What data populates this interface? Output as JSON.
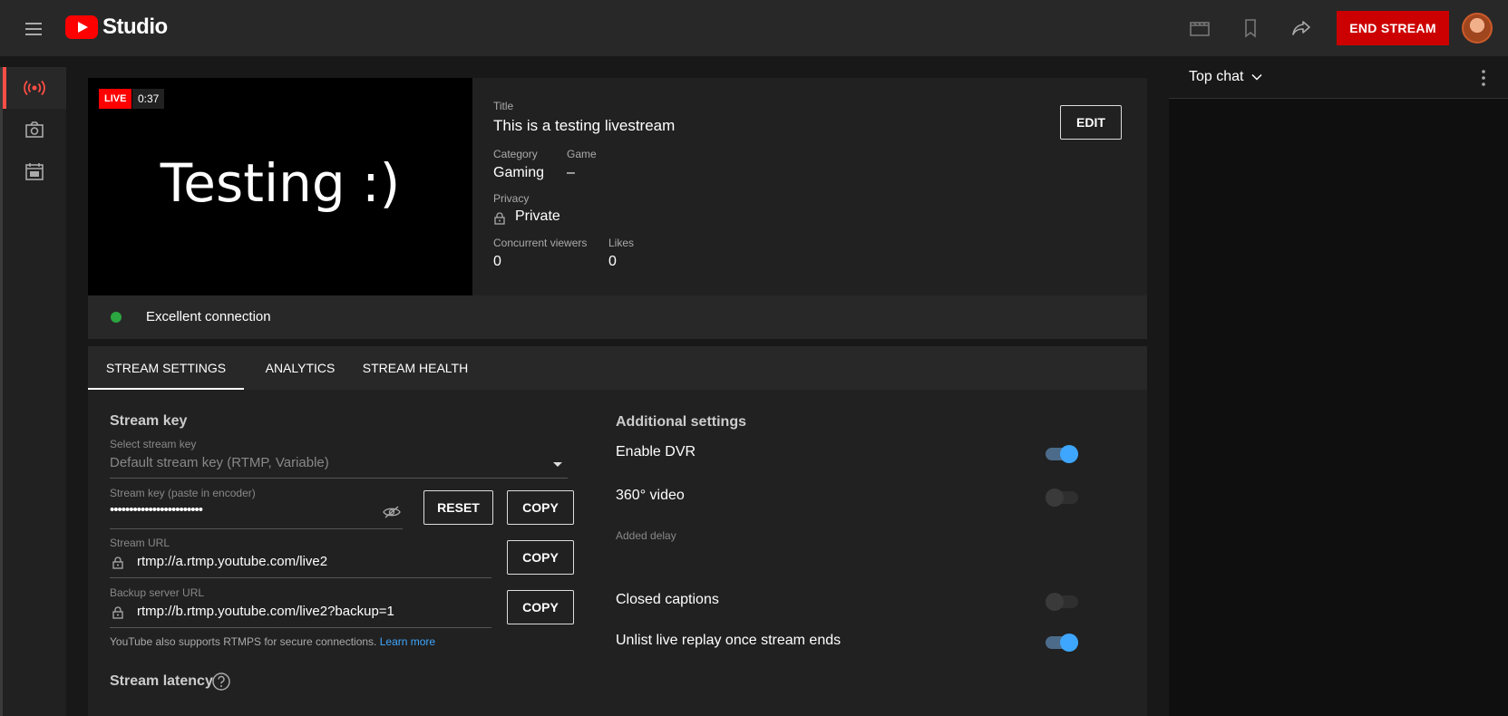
{
  "app": {
    "logo_text": "Studio"
  },
  "header": {
    "end_stream_label": "END STREAM"
  },
  "preview": {
    "live_label": "LIVE",
    "elapsed": "0:37",
    "overlay_text": "Testing :)"
  },
  "stream_info": {
    "title_label": "Title",
    "title_value": "This is a testing livestream",
    "category_label": "Category",
    "category_value": "Gaming",
    "game_label": "Game",
    "game_value": "–",
    "privacy_label": "Privacy",
    "privacy_value": "Private",
    "viewers_label": "Concurrent viewers",
    "viewers_value": "0",
    "likes_label": "Likes",
    "likes_value": "0",
    "edit_label": "EDIT"
  },
  "connection": {
    "status_text": "Excellent connection",
    "status_color": "#2ba640"
  },
  "tabs": [
    {
      "label": "STREAM SETTINGS",
      "active": true
    },
    {
      "label": "ANALYTICS",
      "active": false
    },
    {
      "label": "STREAM HEALTH",
      "active": false
    }
  ],
  "stream_key": {
    "section_title": "Stream key",
    "select_label": "Select stream key",
    "select_value": "Default stream key (RTMP, Variable)",
    "key_label": "Stream key (paste in encoder)",
    "key_value": "••••••••••••••••••••••••",
    "reset_label": "RESET",
    "copy_label": "COPY",
    "url_label": "Stream URL",
    "url_value": "rtmp://a.rtmp.youtube.com/live2",
    "backup_label": "Backup server URL",
    "backup_value": "rtmp://b.rtmp.youtube.com/live2?backup=1",
    "rtmps_note": "YouTube also supports RTMPS for secure connections.",
    "learn_more": "Learn more",
    "latency_title": "Stream latency"
  },
  "additional": {
    "section_title": "Additional settings",
    "dvr_label": "Enable DVR",
    "dvr_on": true,
    "video360_label": "360° video",
    "video360_on": false,
    "delay_label": "Added delay",
    "captions_label": "Closed captions",
    "captions_on": false,
    "unlist_label": "Unlist live replay once stream ends",
    "unlist_on": true
  },
  "chat": {
    "title": "Top chat"
  },
  "colors": {
    "accent": "#3ea6ff",
    "brand": "#ff0000",
    "end_stream": "#cc0000"
  }
}
